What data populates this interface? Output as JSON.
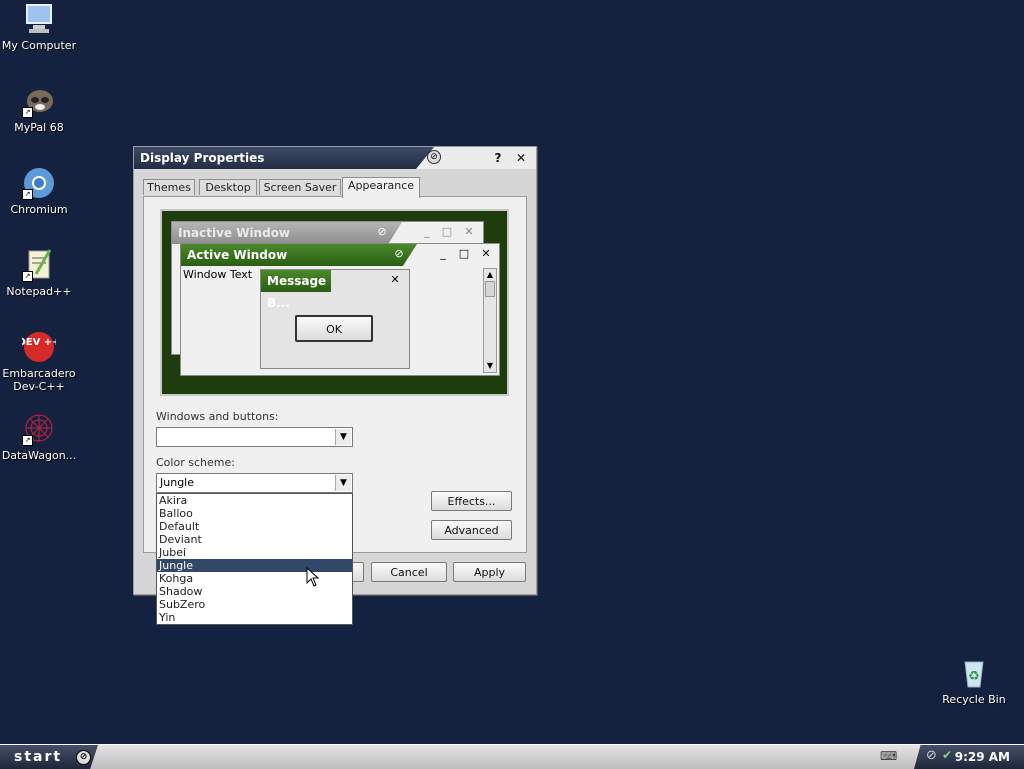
{
  "desktop": {
    "icons": [
      {
        "label": "My Computer",
        "icon": "my-computer-icon"
      },
      {
        "label": "MyPal 68",
        "icon": "mypal-icon"
      },
      {
        "label": "Chromium",
        "icon": "chromium-icon"
      },
      {
        "label": "Notepad++",
        "icon": "notepad-plus-plus-icon"
      },
      {
        "label": "Embarcadero Dev-C++",
        "icon": "devcpp-icon",
        "icon_text": "DEV ++"
      },
      {
        "label": "DataWagon...",
        "icon": "datawagon-icon"
      },
      {
        "label": "Recycle Bin",
        "icon": "recycle-bin-icon"
      }
    ]
  },
  "dialog": {
    "title": "Display Properties",
    "help_label": "?",
    "close_label": "✕",
    "tabs": [
      "Themes",
      "Desktop",
      "Screen Saver",
      "Appearance"
    ],
    "active_tab": "Appearance",
    "preview": {
      "inactive_title": "Inactive Window",
      "active_title": "Active Window",
      "window_text": "Window Text",
      "message_title": "Message B...",
      "ok_label": "OK"
    },
    "windows_buttons_label": "Windows and buttons:",
    "windows_buttons_value": "",
    "color_scheme_label": "Color scheme:",
    "color_scheme_value": "Jungle",
    "color_scheme_options": [
      "Akira",
      "Balloo",
      "Default",
      "Deviant",
      "Jubei",
      "Jungle",
      "Kohga",
      "Shadow",
      "SubZero",
      "Yin"
    ],
    "selected_option_index": 5,
    "effects_label": "Effects...",
    "advanced_label": "Advanced",
    "cancel_label": "Cancel",
    "apply_label": "Apply"
  },
  "taskbar": {
    "start_label": "start",
    "clock": "9:29 AM"
  },
  "colors": {
    "desktop": "#14213f",
    "active_title": "#3a7a20",
    "selection": "#33476a"
  }
}
